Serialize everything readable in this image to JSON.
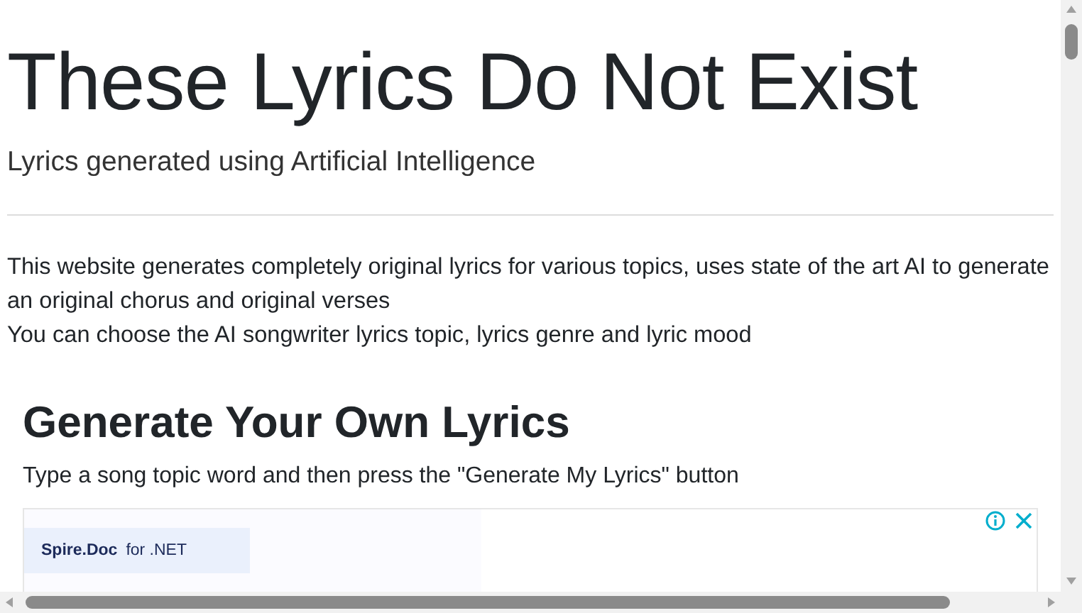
{
  "header": {
    "title": "These Lyrics Do Not Exist",
    "subtitle": "Lyrics generated using Artificial Intelligence"
  },
  "intro": [
    "This website generates completely original lyrics for various topics, uses state of the art AI to generate an original chorus and original verses",
    "You can choose the AI songwriter lyrics topic, lyrics genre and lyric mood"
  ],
  "generator": {
    "heading": "Generate Your Own Lyrics",
    "instructions": "Type a song topic word and then press the \"Generate My Lyrics\" button"
  },
  "ad": {
    "brand": "Spire.Doc",
    "suffix": "for .NET"
  }
}
